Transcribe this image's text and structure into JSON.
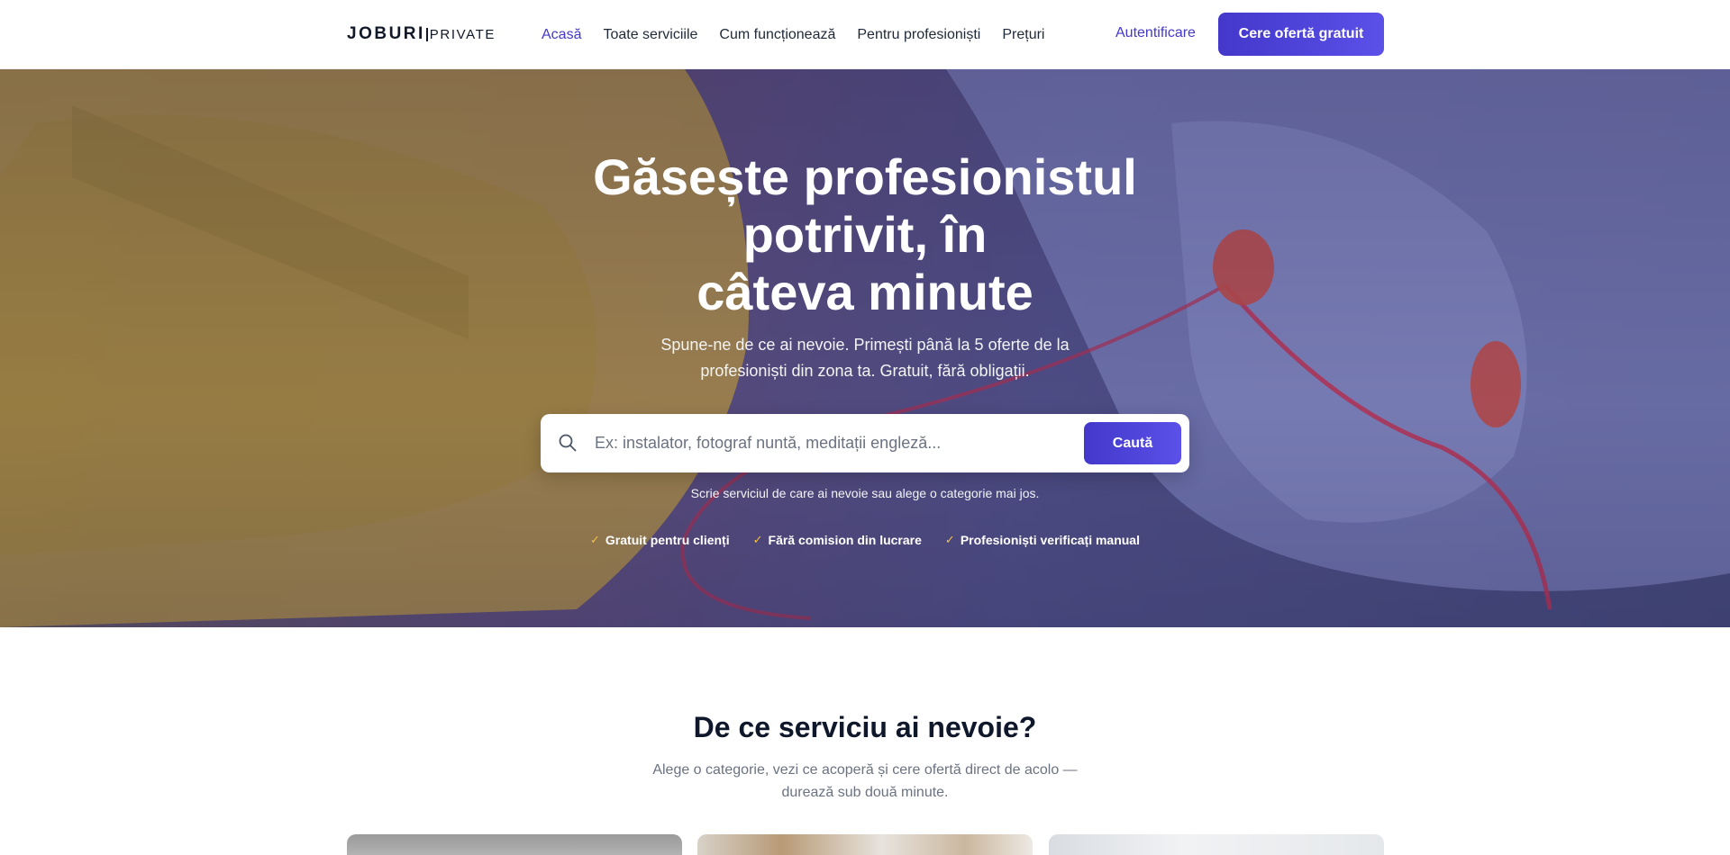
{
  "brand": {
    "logo_main": "JOBURI",
    "logo_sub": "PRIVATE"
  },
  "nav": {
    "items": [
      {
        "label": "Acasă",
        "active": true
      },
      {
        "label": "Toate serviciile",
        "active": false
      },
      {
        "label": "Cum funcționează",
        "active": false
      },
      {
        "label": "Pentru profesioniști",
        "active": false
      },
      {
        "label": "Prețuri",
        "active": false
      }
    ],
    "login_label": "Autentificare",
    "cta_label": "Cere ofertă gratuit"
  },
  "hero": {
    "title_lines": [
      "Găsește profesionistul",
      "potrivit, în",
      "câteva minute"
    ],
    "subtitle_lines": [
      "Spune-ne de ce ai nevoie. Primești până la 5 oferte de la",
      "profesioniști din zona ta. Gratuit, fără obligații."
    ],
    "search": {
      "placeholder": "Ex: instalator, fotograf nuntă, meditații engleză...",
      "value": "",
      "button_label": "Caută",
      "icon": "search-icon"
    },
    "hint": "Scrie serviciul de care ai nevoie sau alege o categorie mai jos.",
    "badges": [
      {
        "icon": "check-icon",
        "label": "Gratuit pentru clienți"
      },
      {
        "icon": "check-icon",
        "label": "Fără comision din lucrare"
      },
      {
        "icon": "check-icon",
        "label": "Profesioniști verificați manual"
      }
    ]
  },
  "services": {
    "title": "De ce serviciu ai nevoie?",
    "subtitle_lines": [
      "Alege o categorie, vezi ce acoperă și cere ofertă direct de acolo —",
      "durează sub două minute."
    ]
  },
  "colors": {
    "accent": "#4338ca",
    "accent_light": "#5b50e8",
    "check": "#f5c048",
    "text_dark": "#0f172a",
    "muted": "#6b7280"
  }
}
